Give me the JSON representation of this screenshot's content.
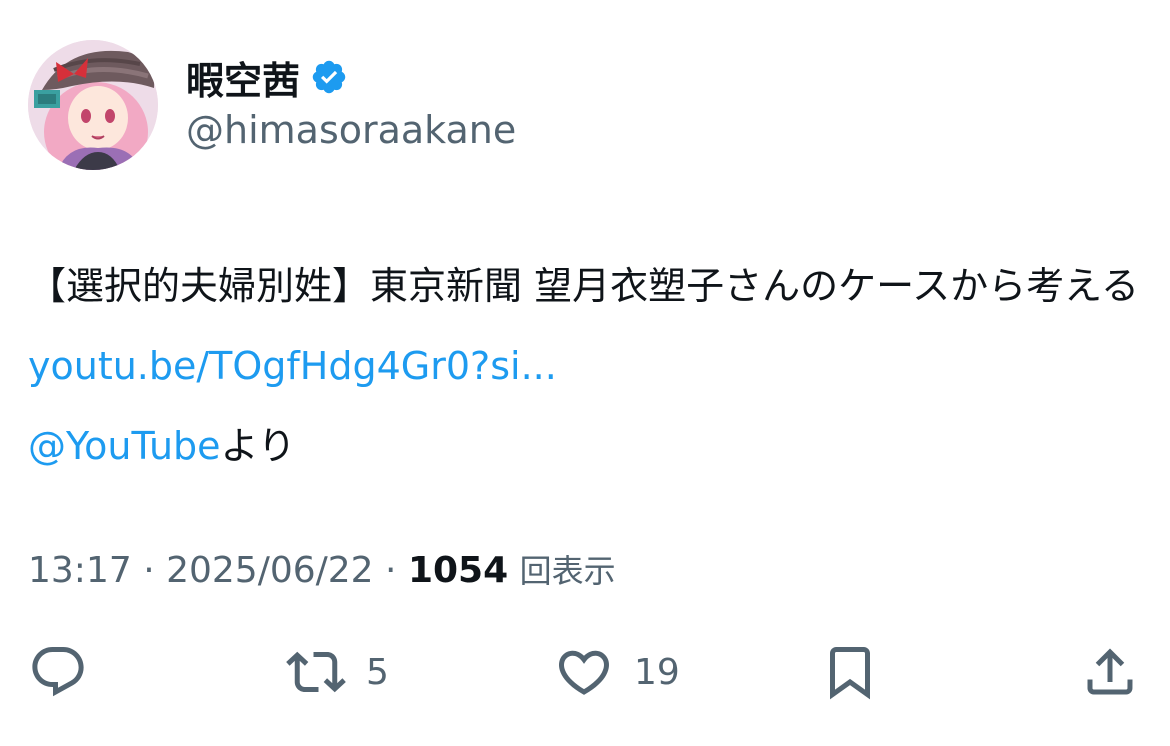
{
  "author": {
    "display_name": "暇空茜",
    "handle": "@himasoraakane",
    "verified": true,
    "avatar_icon": "avatar-image"
  },
  "tweet": {
    "text_part1": "【選択的夫婦別姓】東京新聞 望月衣塑子さんのケースから考える ",
    "link": "youtu.be/TOgfHdg4Gr0?si...",
    "mention": "@YouTube",
    "text_suffix": "より"
  },
  "meta": {
    "time": "13:17",
    "separator": " · ",
    "date": "2025/06/22",
    "views_count": "1054",
    "views_label": "回表示"
  },
  "actions": {
    "reply_count": "",
    "retweet_count": "5",
    "like_count": "19"
  },
  "colors": {
    "link": "#1d9bf0",
    "text": "#0f1419",
    "secondary": "#536471",
    "verified": "#1d9bf0"
  }
}
